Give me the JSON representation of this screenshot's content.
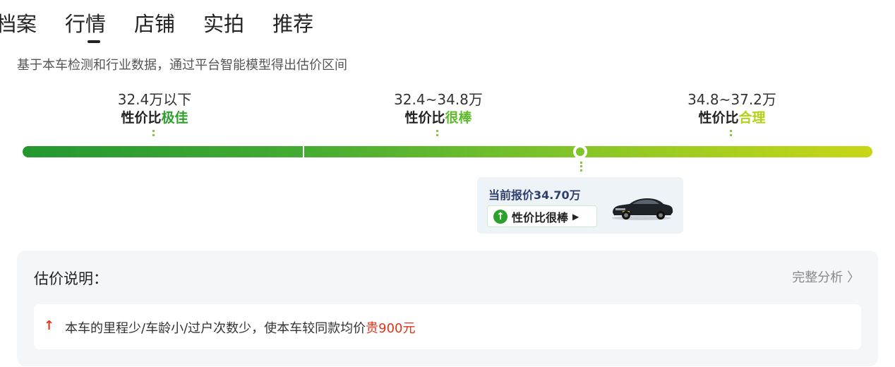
{
  "tabs": [
    "档案",
    "行情",
    "店铺",
    "实拍",
    "推荐"
  ],
  "active_tab": "行情",
  "description": "基于本车检测和行业数据，通过平台智能模型得出估价区间",
  "segments": [
    {
      "range": "32.4万以下",
      "rating_prefix": "性价比",
      "rating_word": "极佳",
      "color": "#2ea02e"
    },
    {
      "range": "32.4~34.8万",
      "rating_prefix": "性价比",
      "rating_word": "很棒",
      "color": "#5dbb2b"
    },
    {
      "range": "34.8~37.2万",
      "rating_prefix": "性价比",
      "rating_word": "合理",
      "color": "#b4d019"
    }
  ],
  "current_price": {
    "label": "当前报价34.70万",
    "rating": "性价比很棒",
    "value_wan": 34.7
  },
  "estimate_panel": {
    "title": "估价说明：",
    "link": "完整分析",
    "note_prefix": "本车的里程少/车龄小/过户次数少，使本车较同款均价",
    "note_amount": "贵900元"
  },
  "colors": {
    "accent_green": "#2ea02e",
    "alert_red": "#e0331c"
  }
}
